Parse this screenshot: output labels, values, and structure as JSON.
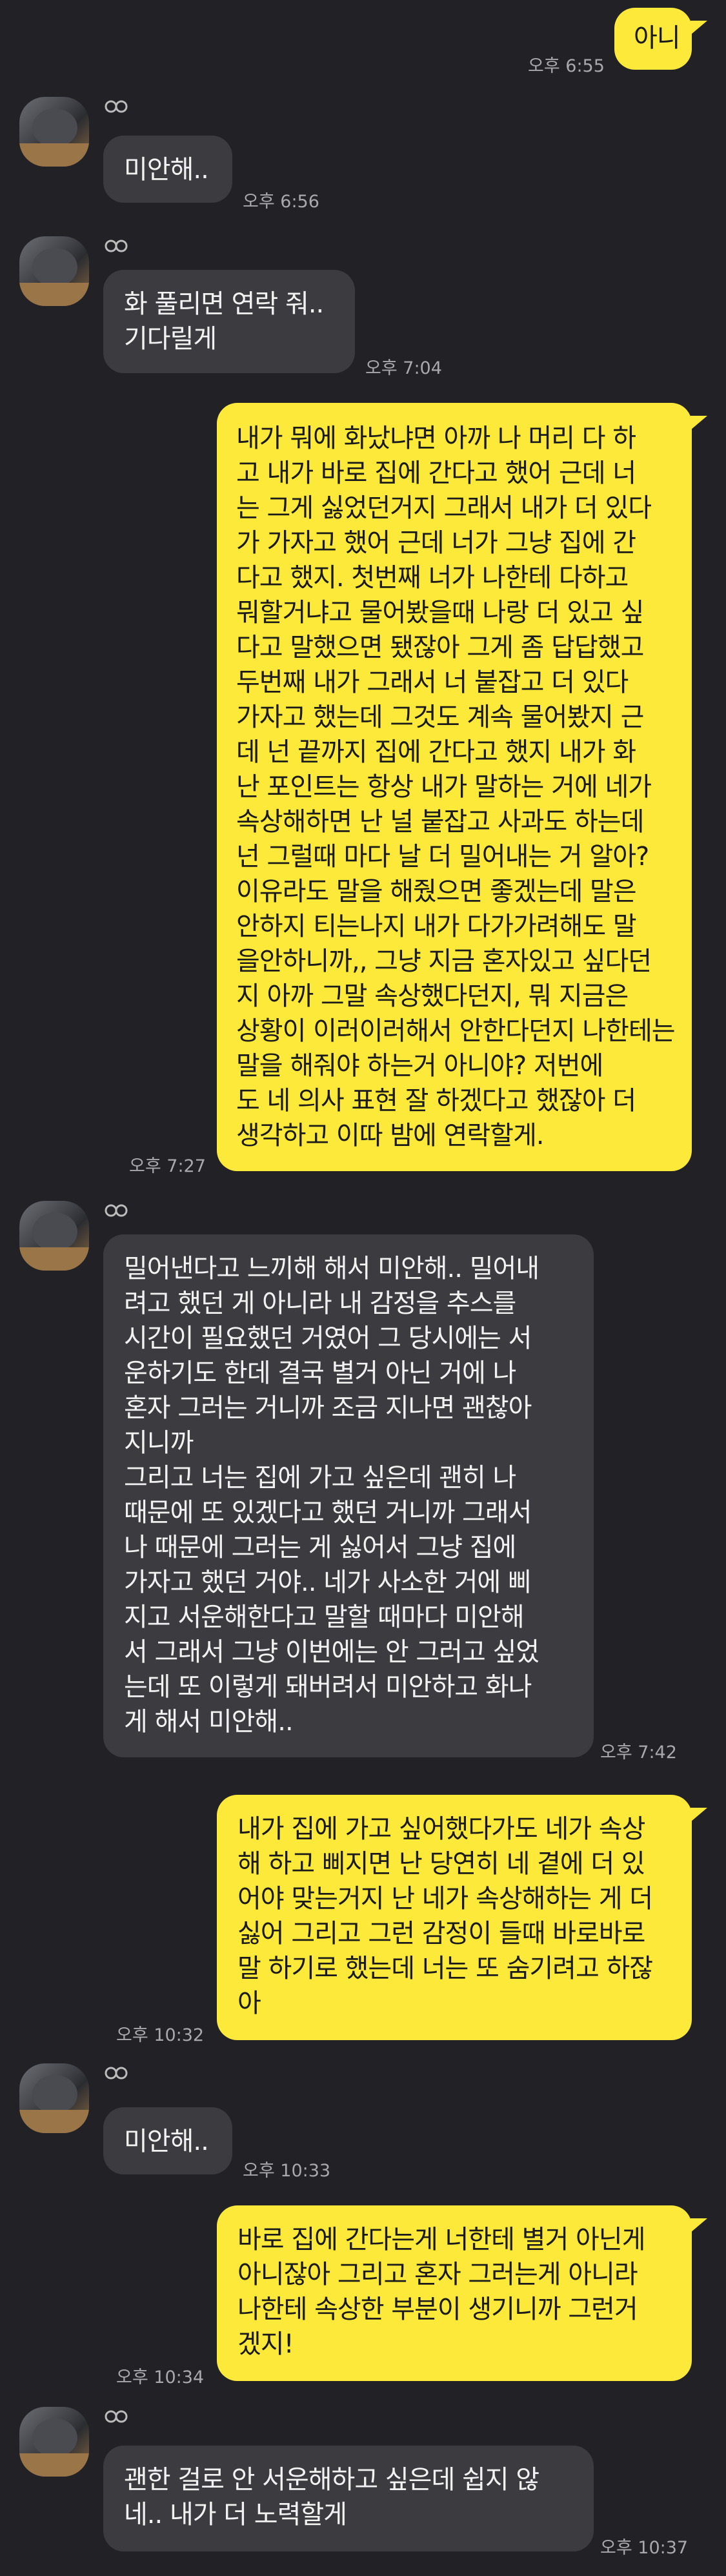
{
  "messages": [
    {
      "dir": "out",
      "text": "아니",
      "time": "오후 6:55"
    },
    {
      "dir": "in",
      "text": "미안해..",
      "time": "오후 6:56"
    },
    {
      "dir": "in",
      "text": "화 풀리면 연락 줘..\n기다릴게",
      "time": "오후 7:04"
    },
    {
      "dir": "out",
      "text": "내가 뭐에 화났냐면 아까 나 머리 다 하\n고 내가 바로 집에 간다고 했어 근데 너\n는 그게 싫었던거지 그래서 내가 더 있다\n가 가자고 했어 근데 너가 그냥 집에 간\n다고 했지. 첫번째 너가 나한테 다하고\n뭐할거냐고 물어봤을때 나랑 더 있고 싶\n다고 말했으면 됐잖아 그게 좀 답답했고\n두번째 내가 그래서 너 붙잡고 더 있다\n가자고 했는데 그것도 계속 물어봤지 근\n데 넌 끝까지 집에 간다고 했지 내가 화\n난 포인트는 항상 내가 말하는 거에 네가\n속상해하면 난 널 붙잡고 사과도 하는데\n넌 그럴때 마다 날 더 밀어내는 거 알아?\n이유라도 말을 해줬으면 좋겠는데 말은\n안하지 티는나지 내가 다가가려해도 말\n을안하니까,, 그냥 지금 혼자있고 싶다던\n지 아까 그말 속상했다던지, 뭐 지금은\n상황이 이러이러해서 안한다던지 나한테는\n말을 해줘야 하는거 아니야? 저번에\n도 네 의사 표현 잘 하겠다고 했잖아 더\n생각하고 이따 밤에 연락할게.",
      "time": "오후 7:27"
    },
    {
      "dir": "in",
      "text": "밀어낸다고 느끼해 해서 미안해.. 밀어내\n려고 했던 게 아니라 내 감정을 추스를\n시간이 필요했던 거였어 그 당시에는 서\n운하기도 한데 결국 별거 아닌 거에 나\n혼자 그러는 거니까 조금 지나면 괜찮아\n지니까\n그리고 너는 집에 가고 싶은데 괜히 나\n때문에 또 있겠다고 했던 거니까 그래서\n나 때문에 그러는 게 싫어서 그냥 집에\n가자고 했던 거야.. 네가 사소한 거에 삐\n지고 서운해한다고 말할 때마다 미안해\n서 그래서 그냥 이번에는 안 그러고 싶었\n는데 또 이렇게 돼버려서 미안하고 화나\n게 해서 미안해..",
      "time": "오후 7:42"
    },
    {
      "dir": "out",
      "text": "내가 집에 가고 싶어했다가도 네가 속상\n해 하고 삐지면 난 당연히 네 곁에 더 있\n어야 맞는거지 난 네가 속상해하는 게 더\n싫어 그리고 그런 감정이 들때 바로바로\n말 하기로 했는데 너는 또 숨기려고 하잖\n아",
      "time": "오후 10:32"
    },
    {
      "dir": "in",
      "text": "미안해..",
      "time": "오후 10:33"
    },
    {
      "dir": "out",
      "text": "바로 집에 간다는게 너한테 별거 아닌게\n아니잖아 그리고 혼자 그러는게 아니라\n나한테 속상한 부분이 생기니까 그런거\n겠지!",
      "time": "오후 10:34"
    },
    {
      "dir": "in",
      "text": "괜한 걸로 안 서운해하고 싶은데 쉽지 않\n네.. 내가 더 노력할게",
      "time": "오후 10:37"
    }
  ]
}
